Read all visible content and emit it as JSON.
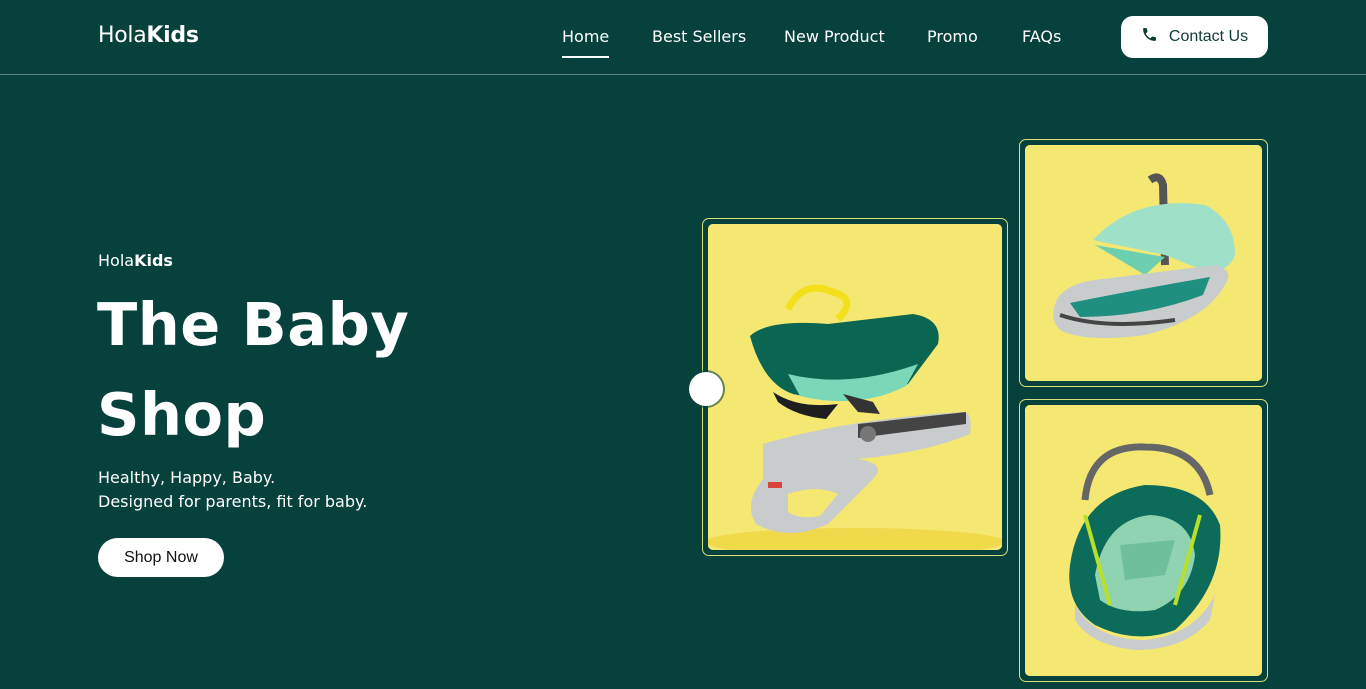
{
  "header": {
    "logo_light": "Hola",
    "logo_bold": "Kids",
    "nav": [
      {
        "label": "Home",
        "active": true
      },
      {
        "label": "Best Sellers",
        "active": false
      },
      {
        "label": "New Product",
        "active": false
      },
      {
        "label": "Promo",
        "active": false
      },
      {
        "label": "FAQs",
        "active": false
      }
    ],
    "contact_label": "Contact Us",
    "contact_icon": "phone-icon"
  },
  "hero": {
    "brand_light": "Hola",
    "brand_bold": "Kids",
    "title_line1": "The Baby",
    "title_line2": "Shop",
    "tagline_line1": "Healthy, Happy, Baby.",
    "tagline_line2": "Designed for parents, fit for baby.",
    "cta_label": "Shop Now"
  },
  "colors": {
    "background": "#06413b",
    "card_background": "#f4e872",
    "card_border": "#d7e27a",
    "button": "#ffffff"
  }
}
